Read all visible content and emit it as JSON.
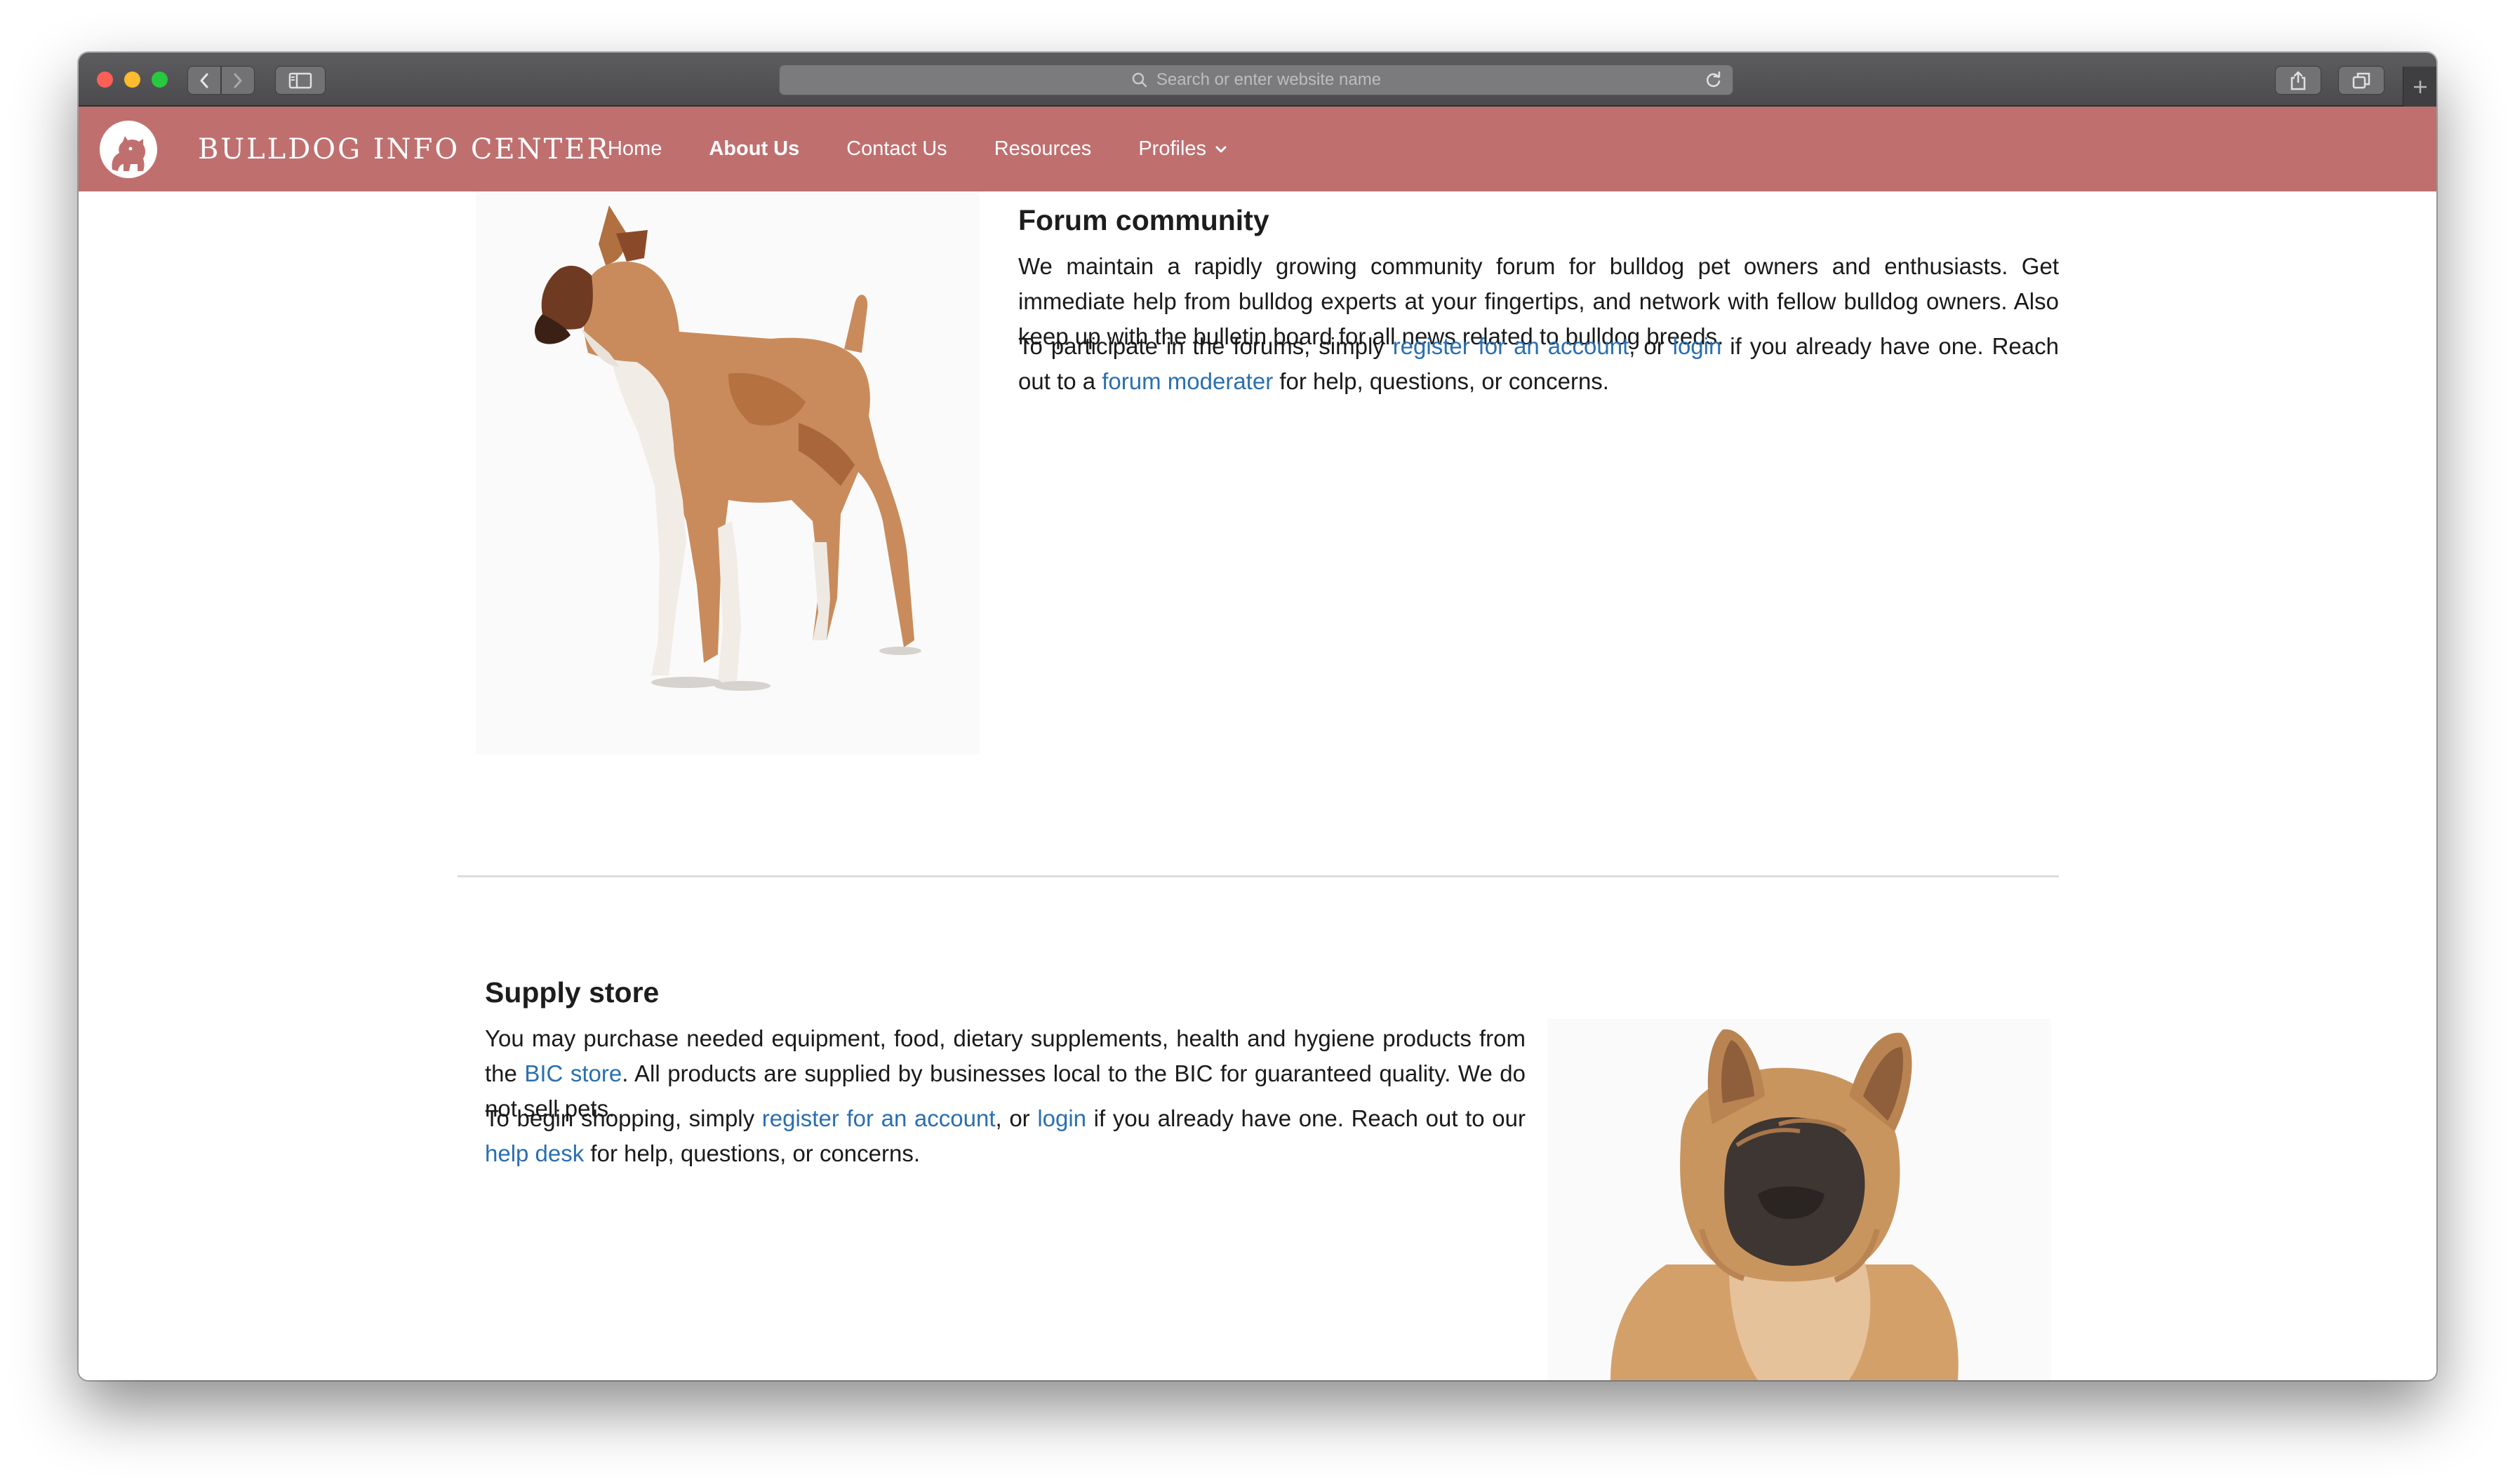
{
  "browser": {
    "address_placeholder": "Search or enter website name"
  },
  "navbar": {
    "brand": "BULLDOG INFO CENTER",
    "links": [
      {
        "label": "Home"
      },
      {
        "label": "About Us"
      },
      {
        "label": "Contact Us"
      },
      {
        "label": "Resources"
      },
      {
        "label": "Profiles"
      }
    ],
    "bg_color": "#c06f6f"
  },
  "forum": {
    "title": "Forum community",
    "p1": "We maintain a rapidly growing community forum for bulldog pet owners and enthusiasts. Get immediate help from bulldog experts at your fingertips, and network with fellow bulldog owners. Also keep up with the bulletin board for all news related to bulldog breeds.",
    "p2_a": "To participate in the forums, simply ",
    "p2_link1": "register for an account",
    "p2_b": ", or ",
    "p2_link2": "login",
    "p2_c": " if you already have one. Reach out to a ",
    "p2_link3": "forum moderater",
    "p2_d": " for help, questions, or concerns."
  },
  "store": {
    "title": "Supply store",
    "p1_a": "You may purchase needed equipment, food, dietary supplements, health and hygiene products from the ",
    "p1_link": "BIC store",
    "p1_b": ". All products are supplied by businesses local to the BIC for guaranteed quality. We do not sell pets.",
    "p2_a": "To begin shopping, simply ",
    "p2_link1": "register for an account",
    "p2_b": ", or ",
    "p2_link2": "login",
    "p2_c": " if you already have one. Reach out to our ",
    "p2_link3": "help desk",
    "p2_d": " for help, questions, or concerns."
  },
  "colors": {
    "link": "#2a6fb0",
    "text": "#1a1a1a"
  }
}
